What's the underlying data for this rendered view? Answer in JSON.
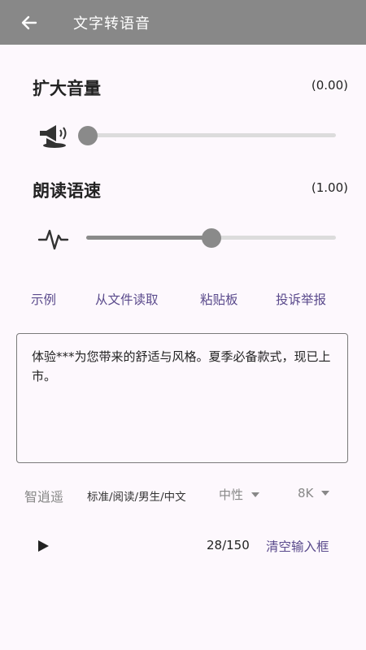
{
  "appbar": {
    "title": "文字转语音"
  },
  "volume": {
    "title": "扩大音量",
    "value_text": "(0.00)",
    "level": 0.0
  },
  "speed": {
    "title": "朗读语速",
    "value_text": "(1.00)",
    "level": 0.5
  },
  "links": [
    "示例",
    "从文件读取",
    "粘贴板",
    "投诉举报"
  ],
  "textbox": {
    "content": "体验***为您带来的舒适与风格。夏季必备款式，现已上市。"
  },
  "options": {
    "voice_name": "智逍遥",
    "voice_desc": "标准/阅读/男生/中文",
    "emotion": "中性",
    "sample_rate": "8K"
  },
  "bottom": {
    "counter": "28/150",
    "clear_label": "清空输入框"
  },
  "colors": {
    "appbar": "#888888",
    "accent": "#5a4a8c",
    "slider": "#8a8a8a"
  }
}
